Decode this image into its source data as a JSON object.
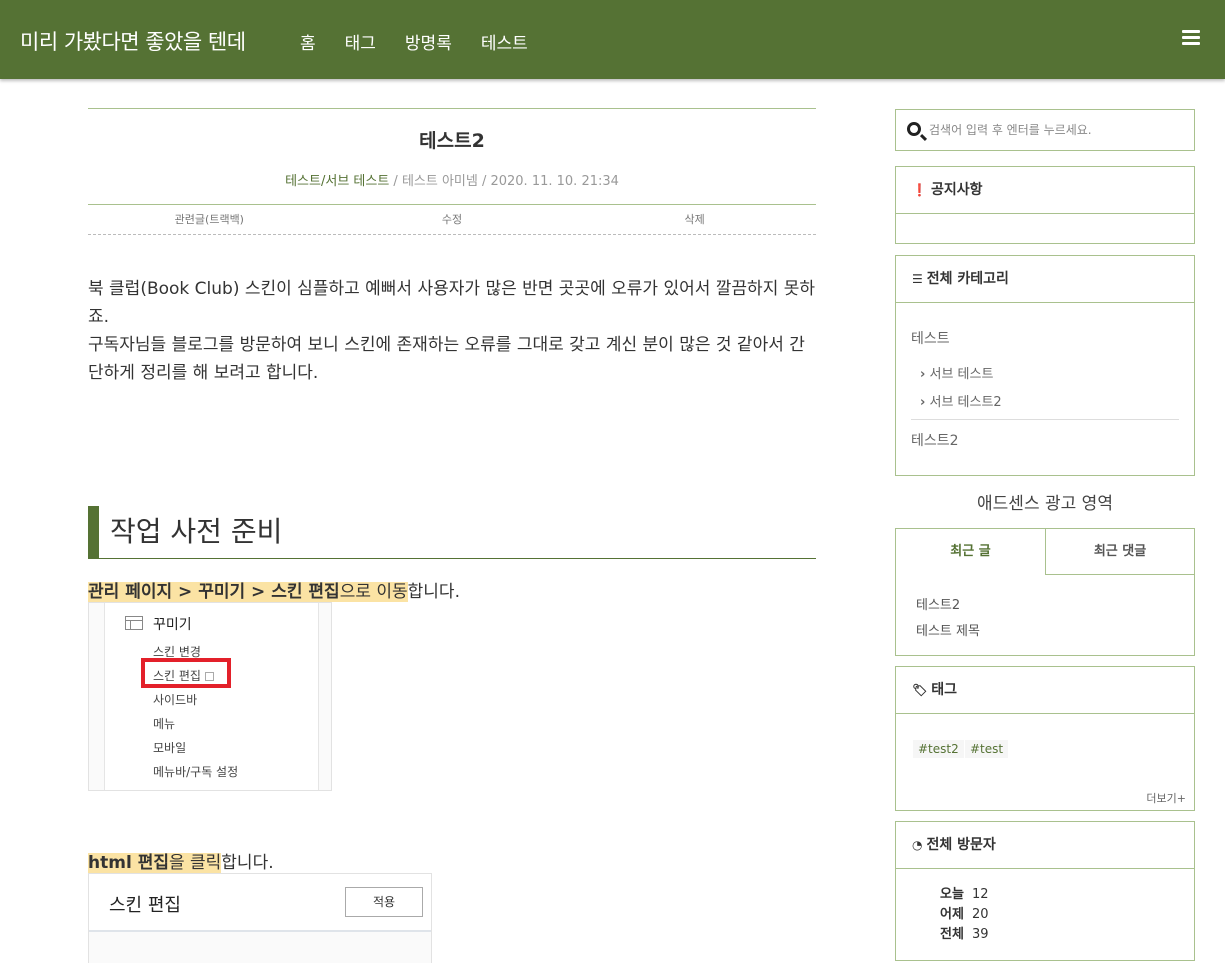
{
  "header": {
    "site_title": "미리 가봤다면 좋았을 텐데",
    "nav": [
      "홈",
      "태그",
      "방명록",
      "테스트"
    ],
    "menu_icon": "hamburger-icon"
  },
  "post": {
    "title": "테스트2",
    "category": "테스트/서브 테스트",
    "meta_rest": " / 테스트 아미넴 / 2020. 11. 10. 21:34",
    "actions": [
      "관련글(트랙백)",
      "수정",
      "삭제"
    ],
    "para1": "북 클럽(Book Club) 스킨이 심플하고 예뻐서 사용자가 많은 반면 곳곳에 오류가 있어서 깔끔하지 못하죠.",
    "para2": "구독자님들 블로그를 방문하여 보니 스킨에 존재하는 오류를 그대로 갖고 계신 분이 많은 것 같아서 간단하게 정리를 해 보려고 합니다.",
    "heading": "작업 사전 준비",
    "step1_bold": "관리 페이지 > 꾸미기 > 스킨 편집",
    "step1_hl": "으로 이동",
    "step1_end": "합니다.",
    "shot1": {
      "title": "꾸미기",
      "items": [
        "스킨 변경",
        "스킨 편집",
        "사이드바",
        "메뉴",
        "모바일",
        "메뉴바/구독 설정"
      ]
    },
    "step2_bold": "html 편집",
    "step2_mid": "을 ",
    "step2_hl": "클릭",
    "step2_end": "합니다.",
    "shot2": {
      "title": "스킨 편집",
      "button": "적용"
    }
  },
  "sidebar": {
    "search_placeholder": "검색어 입력 후 엔터를 누르세요.",
    "notice_title": "공지사항",
    "category_title": "전체 카테고리",
    "categories": {
      "top1": "테스트",
      "subs": [
        "서브 테스트",
        "서브 테스트2"
      ],
      "top2": "테스트2"
    },
    "ad_text": "애드센스 광고 영역",
    "tabs": [
      "최근 글",
      "최근 댓글"
    ],
    "recent_posts": [
      "테스트2",
      "테스트 제목"
    ],
    "tag_title": "태그",
    "tags": [
      "#test2",
      "#test"
    ],
    "more": "더보기+",
    "visitor_title": "전체 방문자",
    "visitors": [
      {
        "label": "오늘",
        "value": "12"
      },
      {
        "label": "어제",
        "value": "20"
      },
      {
        "label": "전체",
        "value": "39"
      }
    ]
  }
}
